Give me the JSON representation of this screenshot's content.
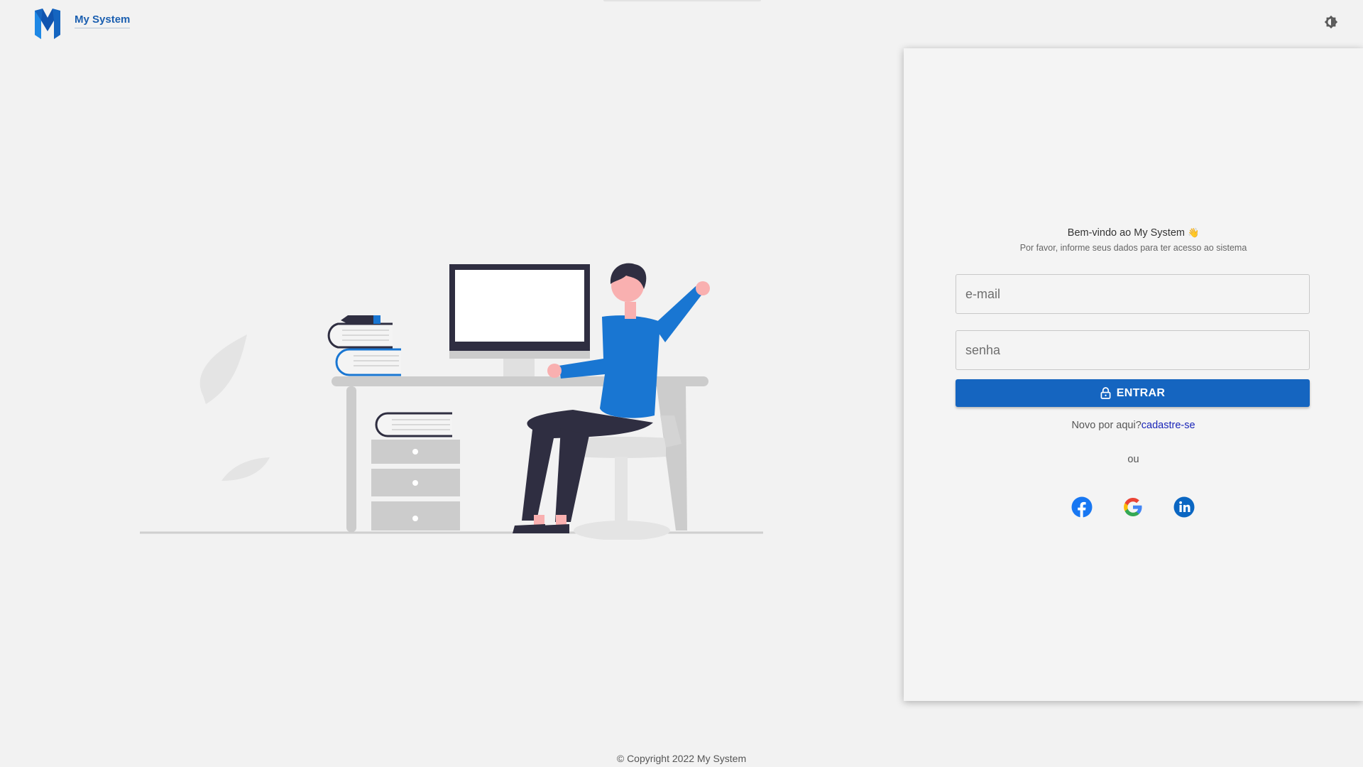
{
  "header": {
    "brand": "My System",
    "icons": {
      "logo": "m-logo",
      "theme": "brightness-icon"
    }
  },
  "login": {
    "welcome": "Bem-vindo ao My System",
    "welcome_emoji": "👋",
    "subtitle": "Por favor, informe seus dados para ter acesso ao sistema",
    "email_placeholder": "e-mail",
    "password_placeholder": "senha",
    "submit_label": "ENTRAR",
    "signup_prompt": "Novo por aqui?",
    "signup_link": "cadastre-se",
    "or_label": "ou",
    "social": [
      "facebook-icon",
      "google-icon",
      "linkedin-icon"
    ]
  },
  "footer": {
    "copyright": "© Copyright 2022 My System"
  },
  "colors": {
    "accent": "#1565c0",
    "background": "#f2f2f2",
    "link": "#1a25b8",
    "illustration_blue": "#1976d2",
    "illustration_dark": "#2f2e41"
  }
}
